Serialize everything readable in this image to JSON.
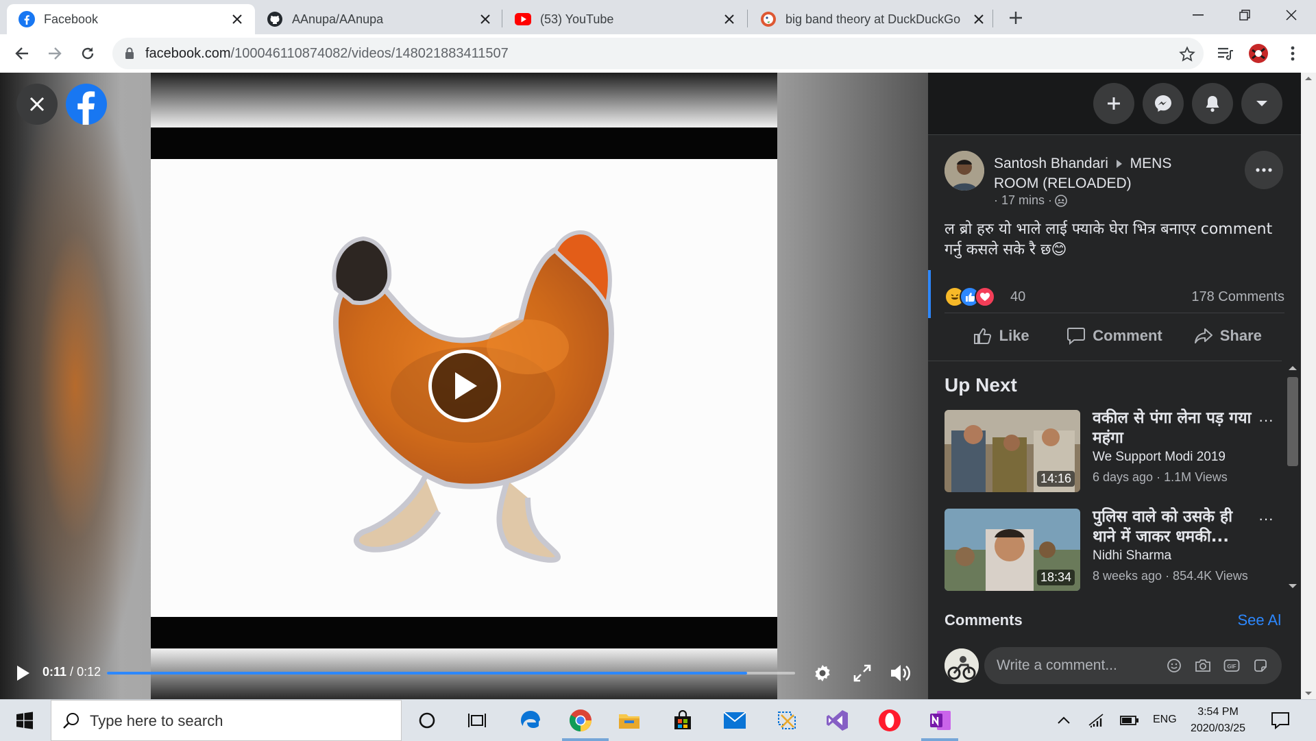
{
  "browser": {
    "tabs": [
      {
        "title": "Facebook",
        "icon": "facebook-icon",
        "active": true
      },
      {
        "title": "AAnupa/AAnupa",
        "icon": "github-icon",
        "active": false
      },
      {
        "title": "(53) YouTube",
        "icon": "youtube-icon",
        "active": false
      },
      {
        "title": "big band theory at DuckDuckGo",
        "icon": "duckduckgo-icon",
        "active": false
      }
    ],
    "url_domain": "facebook.com",
    "url_path": "/100046110874082/videos/148021883411507"
  },
  "player": {
    "time_current": "0:11",
    "time_total": "0:12",
    "progress": 0.93
  },
  "post": {
    "author": "Santosh Bhandari",
    "group": "MENS ROOM (RELOADED)",
    "time": "· 17 mins ·",
    "caption": "ल ब्रो हरु यो भाले लाई फ्याके घेरा भित्र बनाएर comment गर्नु कसले सके रै छ😊",
    "reaction_count": "40",
    "comment_count": "178 Comments",
    "actions": {
      "like": "Like",
      "comment": "Comment",
      "share": "Share"
    }
  },
  "up_next": {
    "heading": "Up Next",
    "items": [
      {
        "title": "वकील से पंगा लेना पड़ गया महंगा",
        "channel": "We Support Modi 2019",
        "meta": "6 days ago · 1.1M Views",
        "duration": "14:16"
      },
      {
        "title": "पुलिस वाले को उसके ही थाने में जाकर धमकी...",
        "channel": "Nidhi Sharma",
        "meta": "8 weeks ago · 854.4K Views",
        "duration": "18:34"
      }
    ]
  },
  "comments": {
    "heading": "Comments",
    "see_all": "See All",
    "placeholder": "Write a comment..."
  },
  "taskbar": {
    "search_placeholder": "Type here to search",
    "language": "ENG",
    "time": "3:54 PM",
    "date": "2020/03/25"
  },
  "colors": {
    "fb_blue": "#1877f2",
    "accent_blue": "#2d88ff",
    "panel_bg": "#242526"
  }
}
